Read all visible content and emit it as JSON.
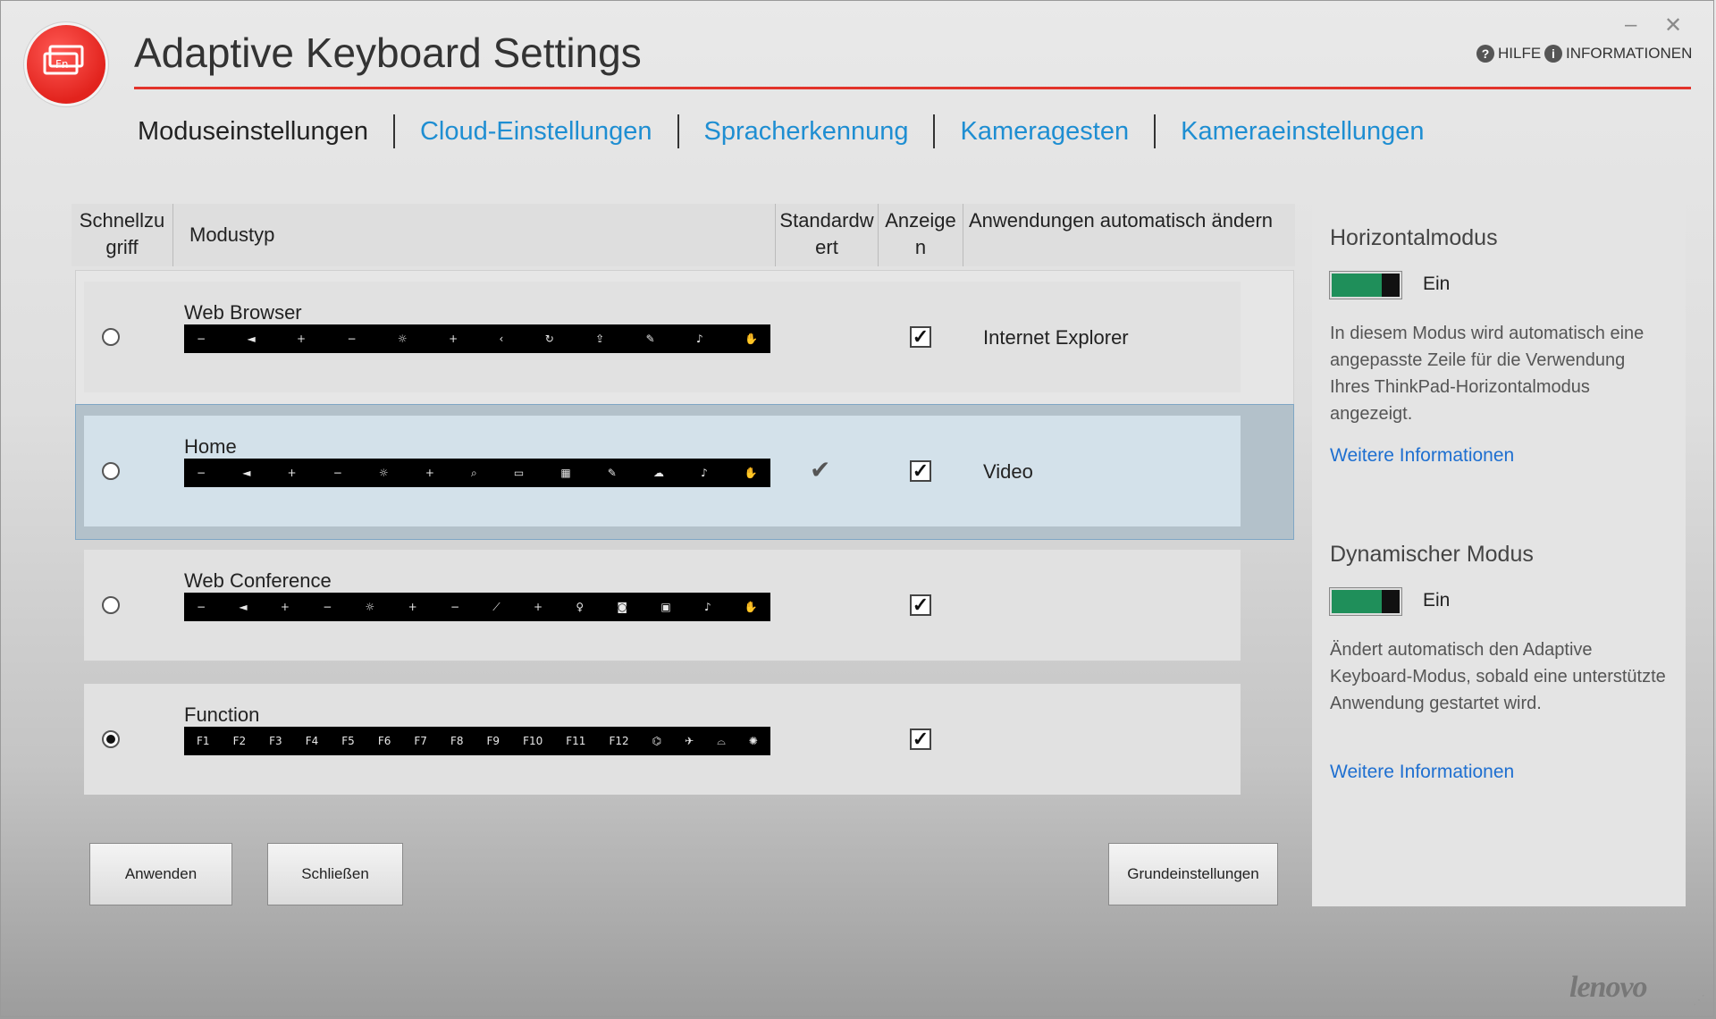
{
  "app": {
    "title": "Adaptive Keyboard Settings",
    "help_label": "HILFE",
    "info_label": "INFORMATIONEN",
    "brand": "lenovo"
  },
  "window_controls": {
    "minimize": "–",
    "close": "✕"
  },
  "tabs": [
    {
      "label": "Moduseinstellungen",
      "active": true
    },
    {
      "label": "Cloud-Einstellungen",
      "active": false
    },
    {
      "label": "Spracherkennung",
      "active": false
    },
    {
      "label": "Kameragesten",
      "active": false
    },
    {
      "label": "Kameraeinstellungen",
      "active": false
    }
  ],
  "table": {
    "headers": {
      "quick_access": "Schnellzugriff",
      "mode_type": "Modustyp",
      "default": "Standardwert",
      "show": "Anzeigen",
      "auto_apps": "Anwendungen automatisch ändern"
    },
    "rows": [
      {
        "name": "Web Browser",
        "radio_checked": false,
        "is_default": false,
        "show": true,
        "app": "Internet Explorer",
        "keys": [
          "−",
          "◄",
          "+",
          "−",
          "☼",
          "+",
          "‹",
          "↻",
          "⇪",
          "✎",
          "♪",
          "✋"
        ]
      },
      {
        "name": "Home",
        "radio_checked": false,
        "is_default": true,
        "show": true,
        "app": "Video",
        "keys": [
          "−",
          "◄",
          "+",
          "−",
          "☼",
          "+",
          "⌕",
          "▭",
          "▦",
          "✎",
          "☁",
          "♪",
          "✋"
        ]
      },
      {
        "name": "Web Conference",
        "radio_checked": false,
        "is_default": false,
        "show": true,
        "app": "",
        "keys": [
          "−",
          "◄",
          "+",
          "−",
          "☼",
          "+",
          "−",
          "⟋",
          "+",
          "♀",
          "◙",
          "▣",
          "♪",
          "✋"
        ]
      },
      {
        "name": "Function",
        "radio_checked": true,
        "is_default": false,
        "show": true,
        "app": "",
        "keys": [
          "F1",
          "F2",
          "F3",
          "F4",
          "F5",
          "F6",
          "F7",
          "F8",
          "F9",
          "F10",
          "F11",
          "F12",
          "⌬",
          "✈",
          "⌓",
          "✺"
        ]
      }
    ]
  },
  "buttons": {
    "apply": "Anwenden",
    "close": "Schließen",
    "defaults": "Grundeinstellungen"
  },
  "side_panel": {
    "horizontal": {
      "title": "Horizontalmodus",
      "toggle_label": "Ein",
      "description": "In diesem Modus wird automatisch eine angepasste Zeile für die Verwendung Ihres ThinkPad-Horizontalmodus angezeigt.",
      "link": "Weitere Informationen"
    },
    "dynamic": {
      "title": "Dynamischer Modus",
      "toggle_label": "Ein",
      "description": "Ändert automatisch den Adaptive Keyboard-Modus, sobald eine unterstützte Anwendung gestartet wird.",
      "link": "Weitere Informationen"
    }
  },
  "colors": {
    "accent_red": "#e2332b",
    "tab_blue": "#1e8ed2",
    "link_blue": "#1e6fd0",
    "toggle_green": "#1f8f5a",
    "selected_row": "#d3e1ea"
  }
}
